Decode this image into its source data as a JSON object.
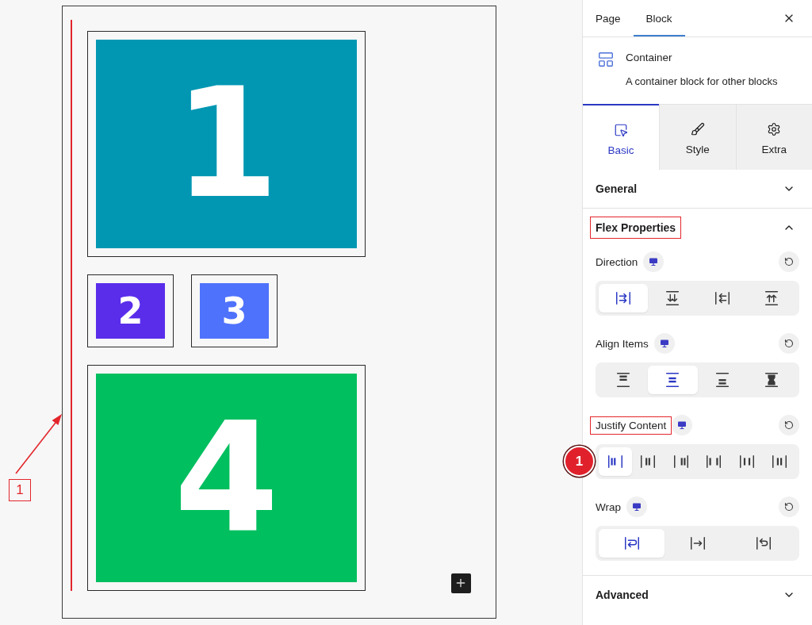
{
  "canvas": {
    "rows": [
      [
        {
          "number": "1",
          "kind": "large",
          "color": "#0197b3"
        }
      ],
      [
        {
          "number": "2",
          "kind": "small",
          "color": "#5a2deb"
        },
        {
          "number": "3",
          "kind": "small",
          "color": "#4f72fc"
        }
      ],
      [
        {
          "number": "4",
          "kind": "large",
          "color": "#00bf5f"
        }
      ]
    ],
    "callout": {
      "label": "1"
    }
  },
  "sidebar": {
    "tabs": [
      {
        "label": "Page",
        "selected": false
      },
      {
        "label": "Block",
        "selected": true
      }
    ],
    "block": {
      "title": "Container",
      "description": "A container block for other blocks"
    },
    "panel_tabs": [
      {
        "label": "Basic",
        "kind": "pointer",
        "selected": true
      },
      {
        "label": "Style",
        "kind": "brush",
        "selected": false
      },
      {
        "label": "Extra",
        "kind": "gear",
        "selected": false
      }
    ],
    "sections": [
      {
        "title": "General",
        "expanded": false,
        "highlighted": false
      },
      {
        "title": "Flex Properties",
        "expanded": true,
        "highlighted": true,
        "controls": [
          {
            "label": "Direction",
            "highlighted": false,
            "options": [
              {
                "kind": "row",
                "selected": true
              },
              {
                "kind": "column",
                "selected": false
              },
              {
                "kind": "row-reverse",
                "selected": false
              },
              {
                "kind": "column-reverse",
                "selected": false
              }
            ]
          },
          {
            "label": "Align Items",
            "highlighted": false,
            "options": [
              {
                "kind": "align-start",
                "selected": false
              },
              {
                "kind": "align-center",
                "selected": true
              },
              {
                "kind": "align-end",
                "selected": false
              },
              {
                "kind": "align-stretch",
                "selected": false
              }
            ]
          },
          {
            "label": "Justify Content",
            "highlighted": true,
            "badge": "1",
            "options": [
              {
                "kind": "justify-start",
                "selected": true
              },
              {
                "kind": "justify-center",
                "selected": false
              },
              {
                "kind": "justify-end",
                "selected": false
              },
              {
                "kind": "justify-between",
                "selected": false
              },
              {
                "kind": "justify-around",
                "selected": false
              },
              {
                "kind": "justify-evenly",
                "selected": false
              }
            ]
          },
          {
            "label": "Wrap",
            "highlighted": false,
            "options": [
              {
                "kind": "wrap",
                "selected": true
              },
              {
                "kind": "nowrap",
                "selected": false
              },
              {
                "kind": "wrap-reverse",
                "selected": false
              }
            ]
          }
        ]
      },
      {
        "title": "Advanced",
        "expanded": false,
        "highlighted": false
      }
    ]
  }
}
